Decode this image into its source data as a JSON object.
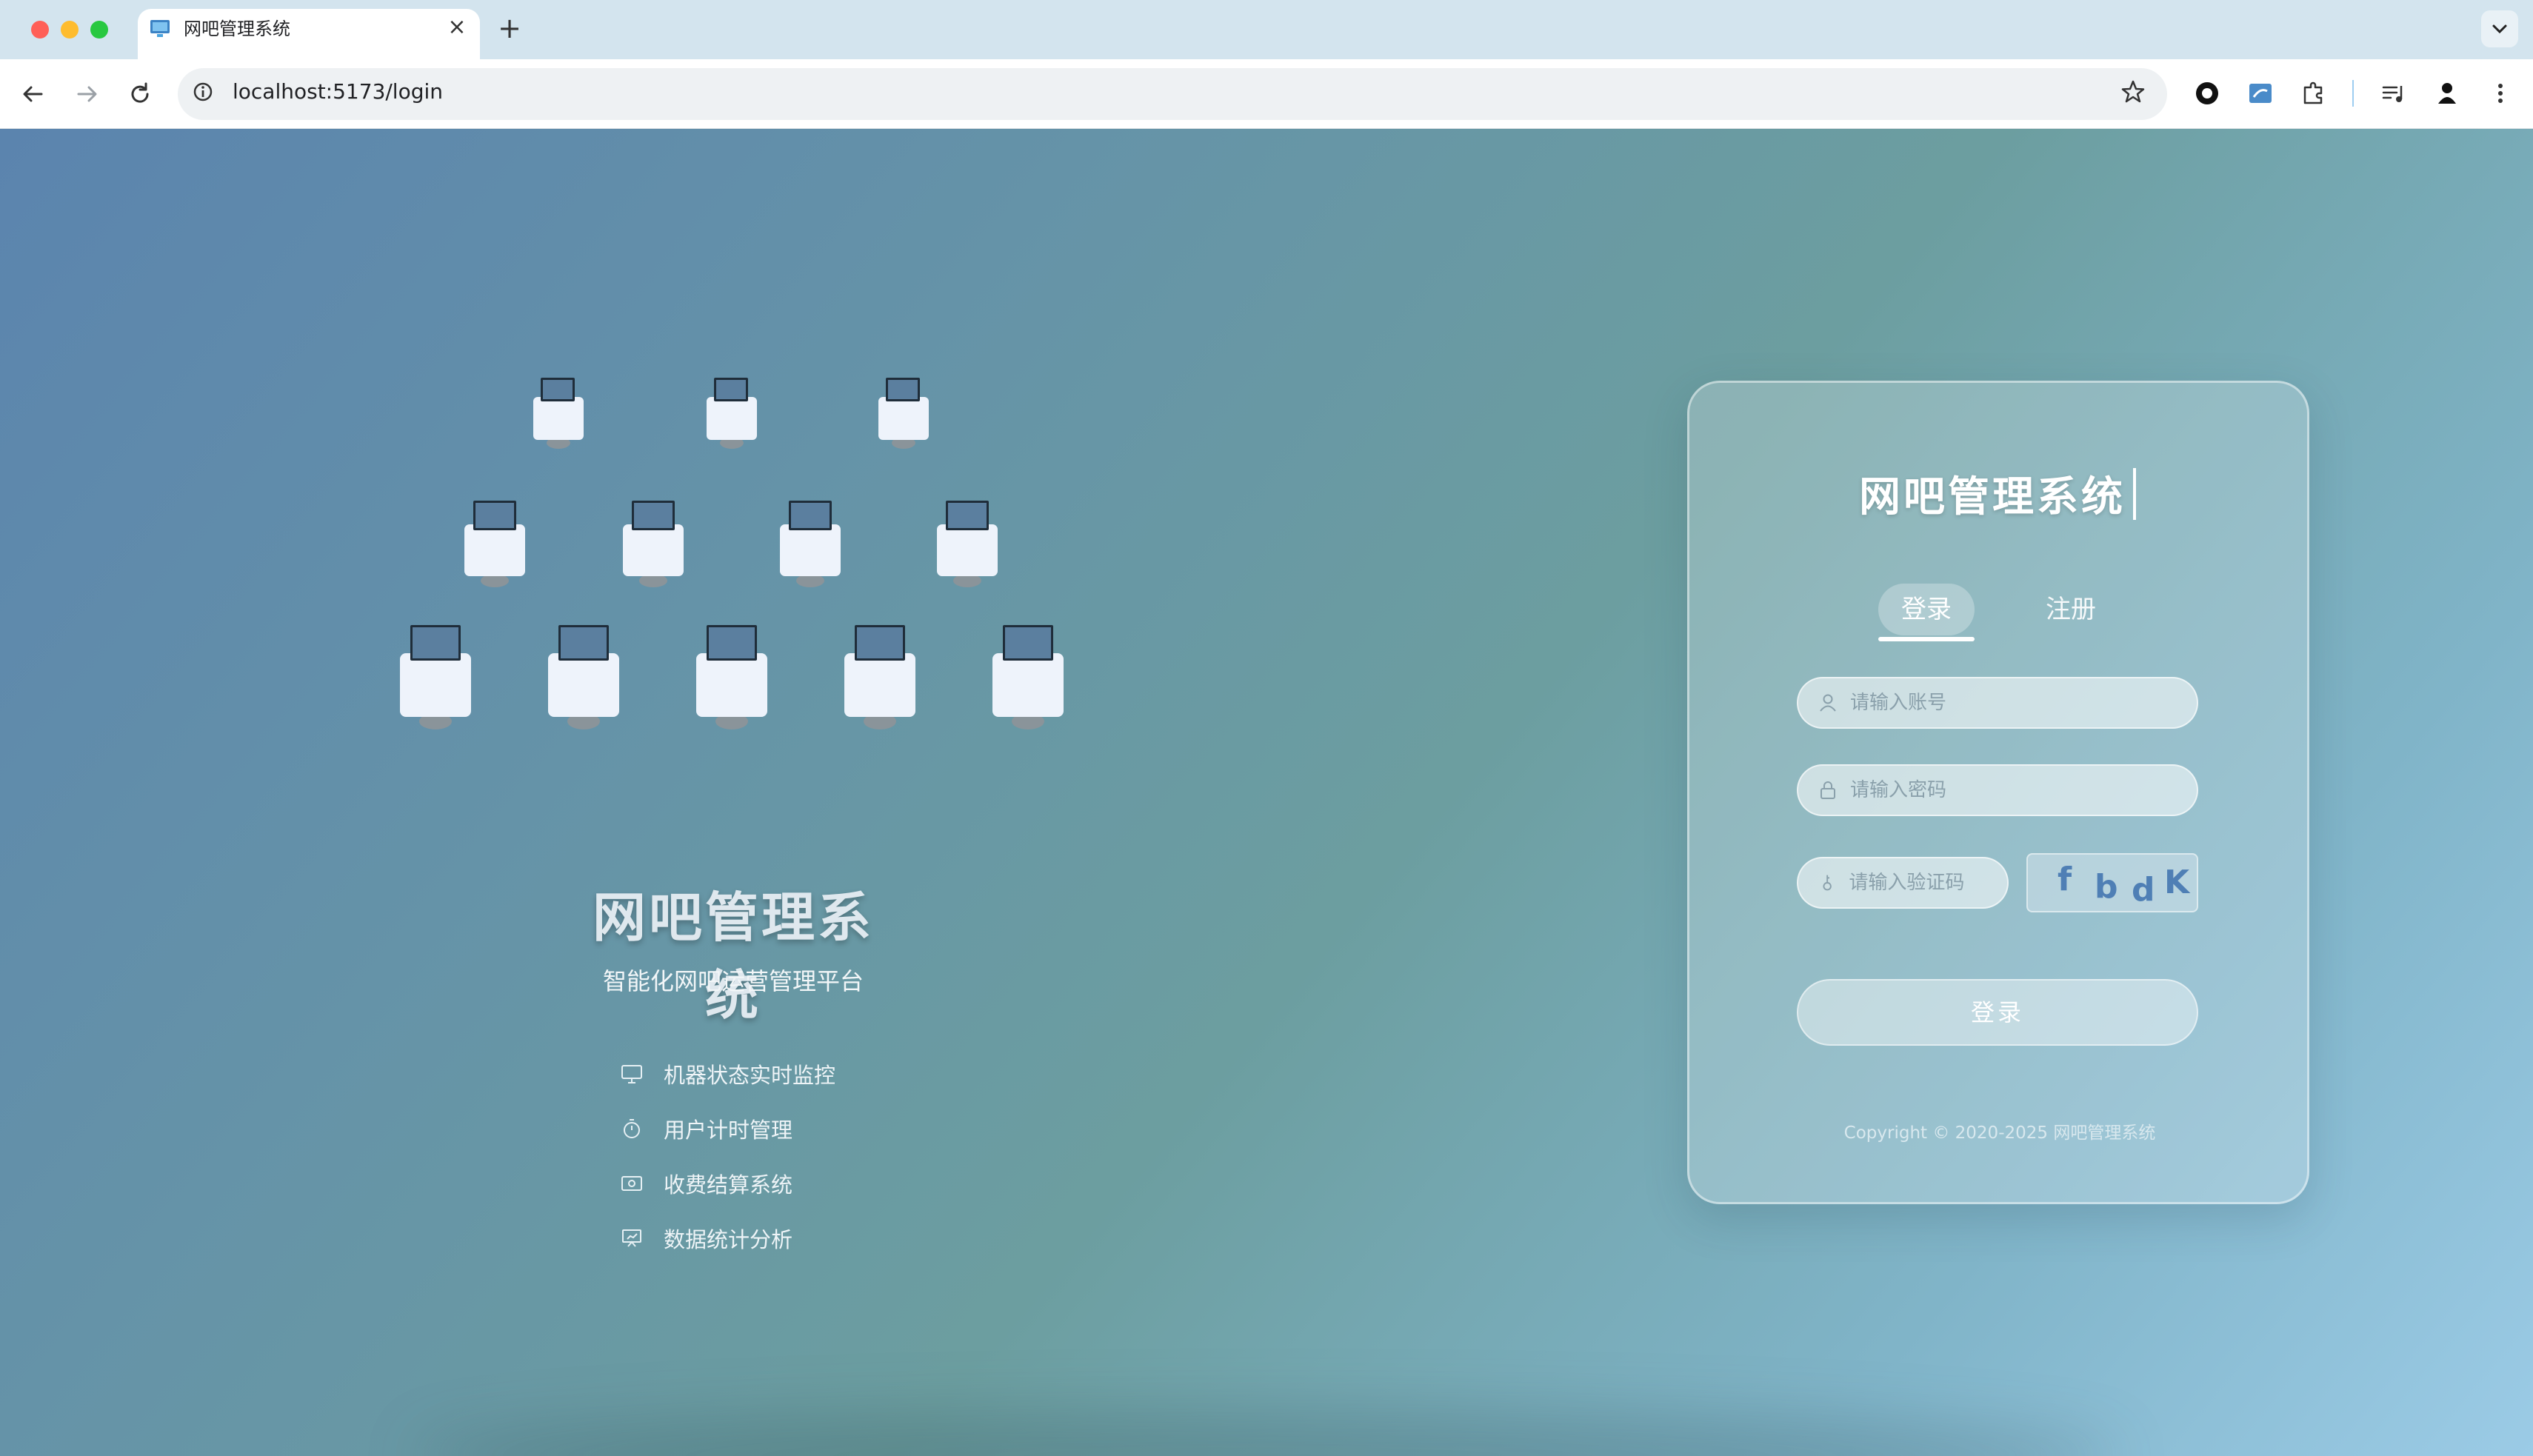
{
  "browser": {
    "tab_title": "网吧管理系统",
    "url": "localhost:5173/login"
  },
  "hero": {
    "title": "网吧管理系统",
    "subtitle": "智能化网吧运营管理平台",
    "features": [
      {
        "icon": "monitor-icon",
        "label": "机器状态实时监控"
      },
      {
        "icon": "timer-icon",
        "label": "用户计时管理"
      },
      {
        "icon": "payment-icon",
        "label": "收费结算系统"
      },
      {
        "icon": "chart-icon",
        "label": "数据统计分析"
      }
    ]
  },
  "login": {
    "title": "网吧管理系统",
    "tabs": {
      "login": "登录",
      "register": "注册"
    },
    "account_placeholder": "请输入账号",
    "password_placeholder": "请输入密码",
    "captcha_placeholder": "请输入验证码",
    "captcha": [
      "f",
      "b",
      "d",
      "K"
    ],
    "submit_label": "登录",
    "copyright": "Copyright © 2020-2025 网吧管理系统"
  },
  "colors": {
    "accent": "#ffffff",
    "captcha_text": "#4f7fb5"
  }
}
